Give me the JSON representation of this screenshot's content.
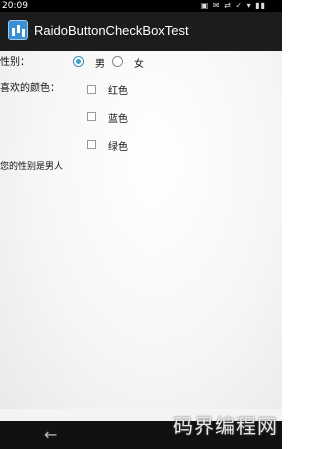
{
  "status_bar": {
    "time": "20:09",
    "icons": "▣ ✉ ⇄ ✓ ▾ ▮▮",
    "clock": "20:09"
  },
  "action_bar": {
    "title": "RaidoButtonCheckBoxTest",
    "icon": "app-launcher-icon"
  },
  "form": {
    "gender_label": "性别：",
    "gender_options": [
      {
        "label": "男",
        "checked": true
      },
      {
        "label": "女",
        "checked": false
      }
    ],
    "color_label": "喜欢的颜色：",
    "color_options": [
      {
        "label": "红色",
        "checked": false
      },
      {
        "label": "蓝色",
        "checked": false
      },
      {
        "label": "绿色",
        "checked": false
      }
    ],
    "result_text": "您的性别是男人"
  },
  "nav_bar": {
    "back_icon": "back-arrow-icon"
  },
  "watermark": "码界编程网"
}
